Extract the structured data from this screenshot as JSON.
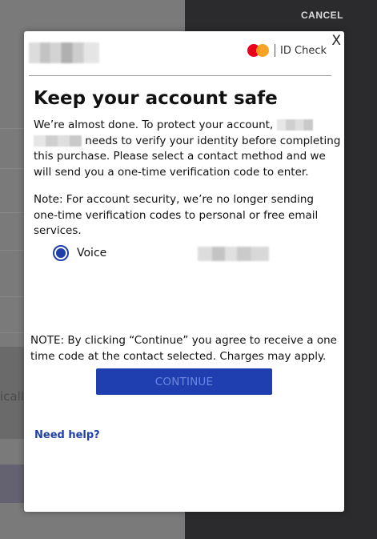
{
  "background": {
    "cancel_label": "CANCEL",
    "partial_text": "icall"
  },
  "modal": {
    "close_label": "X",
    "brand": {
      "name": "ID Check",
      "mastercard_colors": [
        "#eb001b",
        "#f79e1b"
      ]
    },
    "title": "Keep your account safe",
    "intro_part1": "We’re almost done. To protect your account,",
    "intro_part2": "needs to verify your identity before completing this purchase. Please select a contact method and we will send you a one-time verification code to enter.",
    "note": "Note: For account security, we’re no longer sending one-time verification codes to personal or free email services.",
    "contact_option": {
      "label": "Voice",
      "selected": true
    },
    "consent_note": "NOTE: By clicking “Continue” you agree to receive a one time code at the contact selected. Charges may apply.",
    "continue_label": "CONTINUE",
    "help_label": "Need help?"
  },
  "colors": {
    "accent": "#1f3fa8",
    "button_bg": "#1f3fb0",
    "button_text": "#6f86e0"
  }
}
